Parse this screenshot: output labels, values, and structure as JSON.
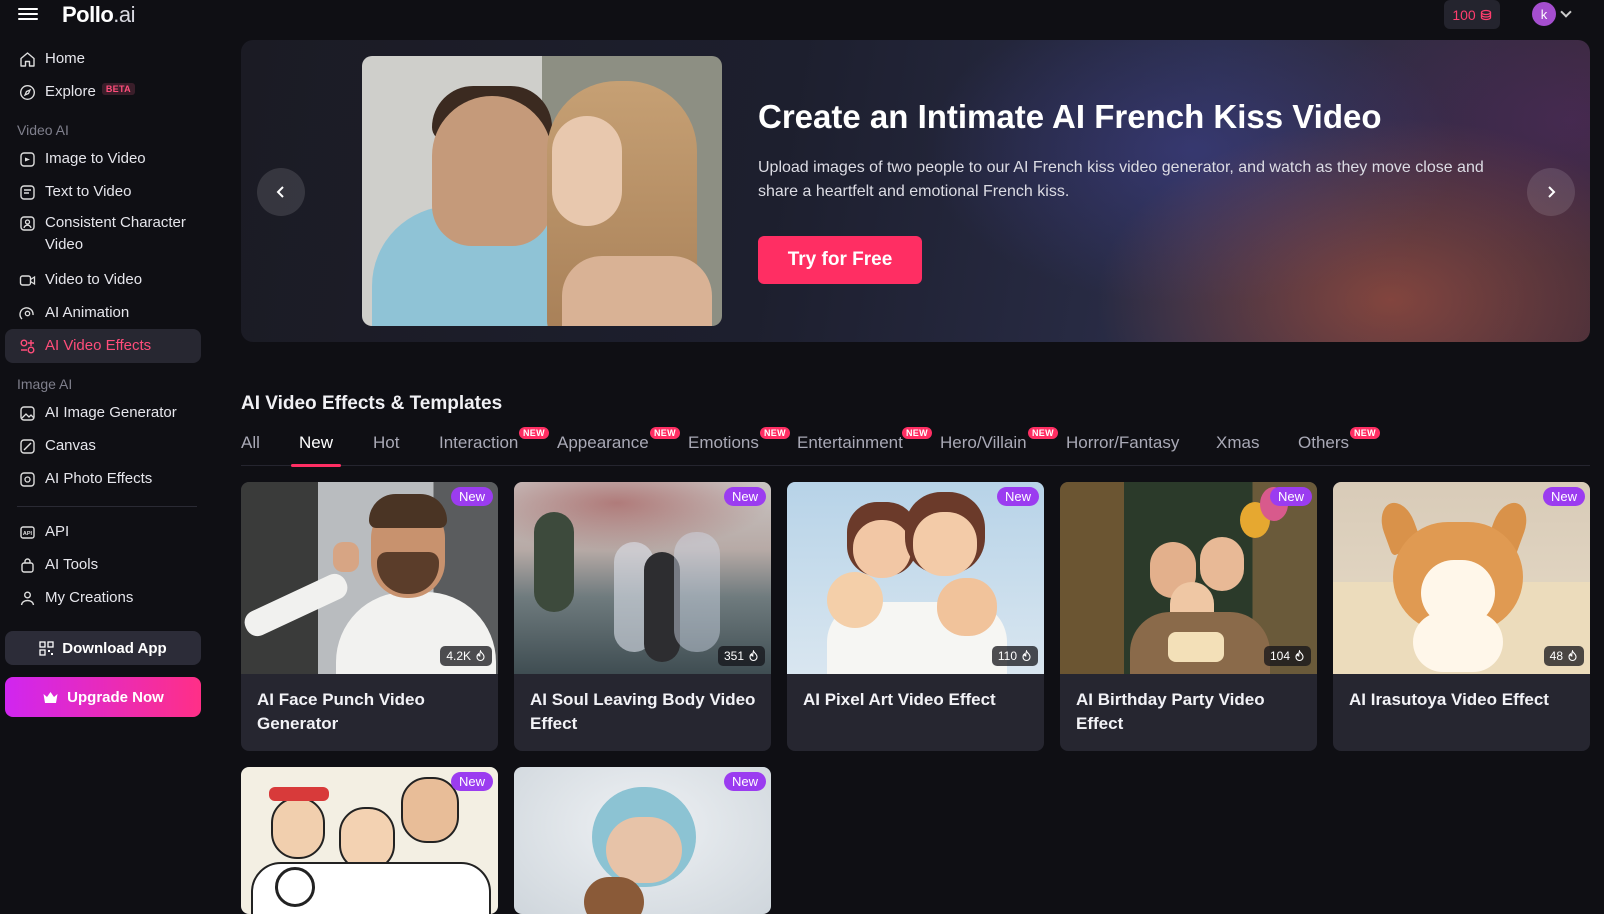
{
  "app": {
    "logo_main": "Pollo",
    "logo_suffix": ".ai"
  },
  "header": {
    "credits": "100",
    "avatar_letter": "k"
  },
  "sidebar": {
    "top_items": [
      {
        "label": "Home",
        "icon": "home-icon"
      },
      {
        "label": "Explore",
        "icon": "compass-icon",
        "badge": "BETA"
      }
    ],
    "video_section_label": "Video AI",
    "video_items": [
      {
        "label": "Image to Video",
        "icon": "image-video-icon"
      },
      {
        "label": "Text to Video",
        "icon": "text-video-icon"
      },
      {
        "label": "Consistent Character Video",
        "icon": "character-video-icon"
      },
      {
        "label": "Video to Video",
        "icon": "video-video-icon"
      },
      {
        "label": "AI Animation",
        "icon": "animation-icon"
      },
      {
        "label": "AI Video Effects",
        "icon": "effects-icon",
        "active": true
      }
    ],
    "image_section_label": "Image AI",
    "image_items": [
      {
        "label": "AI Image Generator",
        "icon": "image-generator-icon"
      },
      {
        "label": "Canvas",
        "icon": "canvas-icon"
      },
      {
        "label": "AI Photo Effects",
        "icon": "photo-effects-icon"
      }
    ],
    "bottom_items": [
      {
        "label": "API",
        "icon": "api-icon"
      },
      {
        "label": "AI Tools",
        "icon": "tools-icon"
      },
      {
        "label": "My Creations",
        "icon": "creations-icon"
      }
    ],
    "download_label": "Download App",
    "upgrade_label": "Upgrade Now"
  },
  "hero": {
    "title": "Create an Intimate AI French Kiss Video",
    "description": "Upload images of two people to our AI French kiss video generator, and watch as they move close and share a heartfelt and emotional French kiss.",
    "cta": "Try for Free"
  },
  "section": {
    "title": "AI Video Effects & Templates",
    "tabs": [
      {
        "label": "All"
      },
      {
        "label": "New",
        "active": true
      },
      {
        "label": "Hot"
      },
      {
        "label": "Interaction",
        "badge": "NEW"
      },
      {
        "label": "Appearance",
        "badge": "NEW"
      },
      {
        "label": "Emotions",
        "badge": "NEW"
      },
      {
        "label": "Entertainment",
        "badge": "NEW"
      },
      {
        "label": "Hero/Villain",
        "badge": "NEW"
      },
      {
        "label": "Horror/Fantasy"
      },
      {
        "label": "Xmas"
      },
      {
        "label": "Others",
        "badge": "NEW"
      }
    ]
  },
  "cards": [
    {
      "title": "AI Face Punch Video Generator",
      "badge": "New",
      "count": "4.2K"
    },
    {
      "title": "AI Soul Leaving Body Video Effect",
      "badge": "New",
      "count": "351"
    },
    {
      "title": "AI Pixel Art Video Effect",
      "badge": "New",
      "count": "110"
    },
    {
      "title": "AI Birthday Party Video Effect",
      "badge": "New",
      "count": "104"
    },
    {
      "title": "AI Irasutoya Video Effect",
      "badge": "New",
      "count": "48"
    },
    {
      "title": "",
      "badge": "New",
      "count": ""
    },
    {
      "title": "",
      "badge": "New",
      "count": ""
    }
  ],
  "colors": {
    "accent": "#ff2e63",
    "badge_purple": "#9b3cf0",
    "background": "#0f0f14"
  }
}
